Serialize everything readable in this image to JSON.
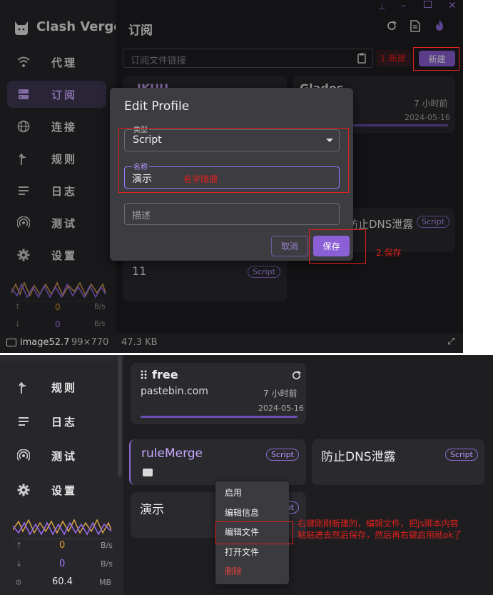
{
  "app": {
    "title": "Clash Verge"
  },
  "window": {
    "pin": "pin-icon",
    "min": "minimize-icon",
    "max": "maximize-icon",
    "close": "close-icon"
  },
  "sidebar": {
    "items": [
      {
        "label": "代理",
        "icon": "wifi-icon"
      },
      {
        "label": "订阅",
        "icon": "server-icon"
      },
      {
        "label": "连接",
        "icon": "globe-icon"
      },
      {
        "label": "规则",
        "icon": "route-icon"
      },
      {
        "label": "日志",
        "icon": "list-icon"
      },
      {
        "label": "测试",
        "icon": "radar-icon"
      },
      {
        "label": "设置",
        "icon": "gear-icon"
      }
    ],
    "traffic_top": {
      "up": "0",
      "down": "0",
      "unit": "B/s"
    },
    "traffic_bottom": {
      "up": "0",
      "down": "0",
      "unit": "B/s",
      "mem": "60.4",
      "mem_unit": "MB"
    }
  },
  "header": {
    "title": "订阅"
  },
  "toolbar": {
    "url_placeholder": "订阅文件链接",
    "new_label": "新建"
  },
  "cards_top": [
    {
      "name": "JKUU"
    },
    {
      "name": "Glados",
      "time": "7 小时前",
      "date": "2024-05-16"
    },
    {
      "name": "防止DNS泄露",
      "tag": "Script"
    },
    {
      "name": "11",
      "tag": "Script"
    }
  ],
  "dialog": {
    "title": "Edit Profile",
    "type_label": "类型",
    "type_value": "Script",
    "name_label": "名称",
    "name_value": "演示",
    "desc_placeholder": "描述",
    "cancel_label": "取消",
    "save_label": "保存"
  },
  "annotations_top": {
    "step1": "1.新建",
    "name_hint": "名字随便",
    "step2": "2.保存"
  },
  "image_info": {
    "text": "image52.7",
    "dims": "99×770",
    "size": "47.3 KB"
  },
  "cards_bottom": [
    {
      "name": "free",
      "url": "pastebin.com",
      "time": "7 小时前",
      "date": "2024-05-16"
    },
    {
      "name": "ruleMerge",
      "tag": "Script"
    },
    {
      "name": "防止DNS泄露",
      "tag": "Script"
    },
    {
      "name": "演示",
      "tag": "Script"
    }
  ],
  "context_menu": {
    "items": [
      "启用",
      "编辑信息",
      "编辑文件",
      "打开文件",
      "删除"
    ]
  },
  "annotations_bottom": {
    "note_line1": "右键刚刚新建的，编辑文件，把js脚本内容",
    "note_line2": "粘贴进去然后保存，然后再右键启用就ok了"
  },
  "colors": {
    "accent": "#8b5fd6",
    "accent_text": "#b596ff",
    "red": "#e0201b",
    "bg": "#1e1e21"
  }
}
